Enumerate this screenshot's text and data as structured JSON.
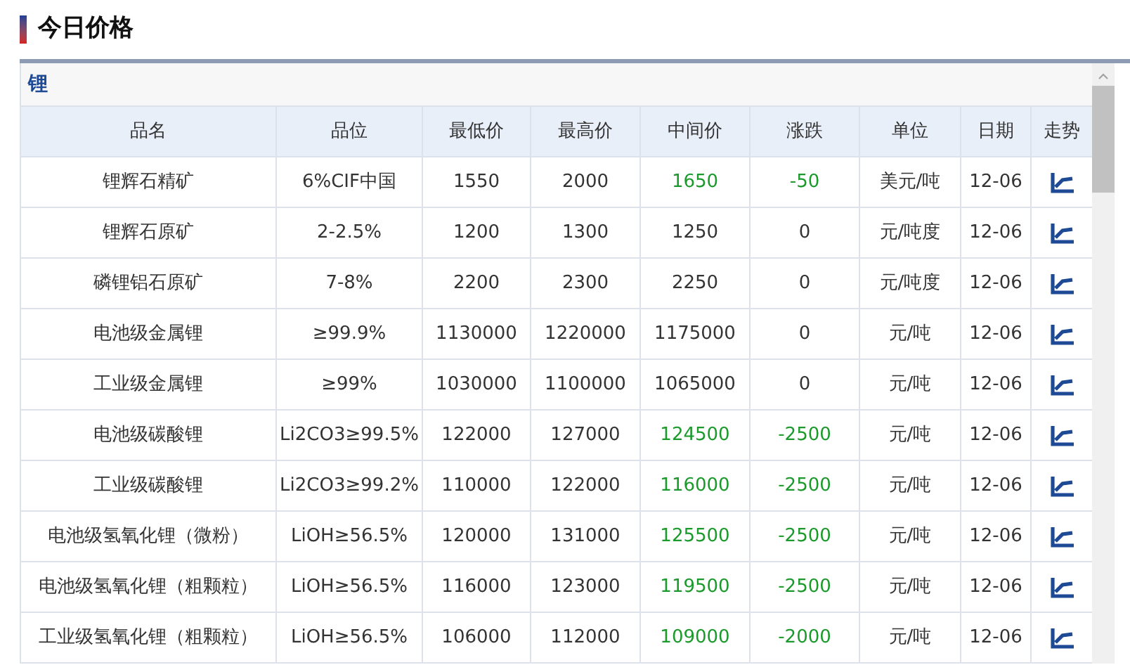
{
  "section_title": "今日价格",
  "category": "锂",
  "table": {
    "columns": [
      "品名",
      "品位",
      "最低价",
      "最高价",
      "中间价",
      "涨跌",
      "单位",
      "日期",
      "走势"
    ],
    "rows": [
      {
        "kind": "down",
        "name": "锂辉石精矿",
        "grade": "6%CIF中国",
        "low": "1550",
        "high": "2000",
        "mid": "1650",
        "change": "-50",
        "unit": "美元/吨",
        "date": "12-06"
      },
      {
        "kind": "flat",
        "name": "锂辉石原矿",
        "grade": "2-2.5%",
        "low": "1200",
        "high": "1300",
        "mid": "1250",
        "change": "0",
        "unit": "元/吨度",
        "date": "12-06"
      },
      {
        "kind": "flat",
        "name": "磷锂铝石原矿",
        "grade": "7-8%",
        "low": "2200",
        "high": "2300",
        "mid": "2250",
        "change": "0",
        "unit": "元/吨度",
        "date": "12-06"
      },
      {
        "kind": "flat",
        "name": "电池级金属锂",
        "grade": "≥99.9%",
        "low": "1130000",
        "high": "1220000",
        "mid": "1175000",
        "change": "0",
        "unit": "元/吨",
        "date": "12-06"
      },
      {
        "kind": "flat",
        "name": "工业级金属锂",
        "grade": "≥99%",
        "low": "1030000",
        "high": "1100000",
        "mid": "1065000",
        "change": "0",
        "unit": "元/吨",
        "date": "12-06"
      },
      {
        "kind": "down",
        "name": "电池级碳酸锂",
        "grade": "Li2CO3≥99.5%",
        "low": "122000",
        "high": "127000",
        "mid": "124500",
        "change": "-2500",
        "unit": "元/吨",
        "date": "12-06"
      },
      {
        "kind": "down",
        "name": "工业级碳酸锂",
        "grade": "Li2CO3≥99.2%",
        "low": "110000",
        "high": "122000",
        "mid": "116000",
        "change": "-2500",
        "unit": "元/吨",
        "date": "12-06"
      },
      {
        "kind": "down",
        "name": "电池级氢氧化锂（微粉）",
        "grade": "LiOH≥56.5%",
        "low": "120000",
        "high": "131000",
        "mid": "125500",
        "change": "-2500",
        "unit": "元/吨",
        "date": "12-06"
      },
      {
        "kind": "down",
        "name": "电池级氢氧化锂（粗颗粒）",
        "grade": "LiOH≥56.5%",
        "low": "116000",
        "high": "123000",
        "mid": "119500",
        "change": "-2500",
        "unit": "元/吨",
        "date": "12-06"
      },
      {
        "kind": "down",
        "name": "工业级氢氧化锂（粗颗粒）",
        "grade": "LiOH≥56.5%",
        "low": "106000",
        "high": "112000",
        "mid": "109000",
        "change": "-2000",
        "unit": "元/吨",
        "date": "12-06"
      }
    ]
  }
}
